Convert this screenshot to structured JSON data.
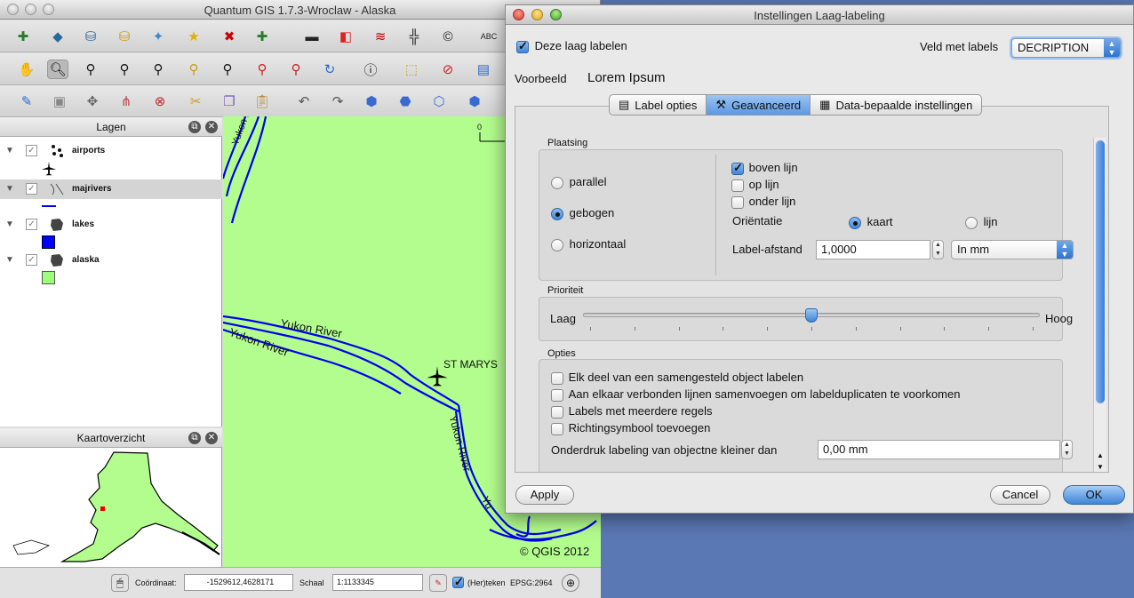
{
  "main_window": {
    "title": "Quantum GIS 1.7.3-Wroclaw - Alaska",
    "layers_panel": {
      "title": "Lagen",
      "layers": [
        {
          "name": "airports",
          "checked": true,
          "symbol": "airplane-icon"
        },
        {
          "name": "majrivers",
          "checked": true,
          "symbol": "line-icon",
          "color": "#0000ee"
        },
        {
          "name": "lakes",
          "checked": true,
          "symbol": "polygon-icon",
          "color": "#0000ff"
        },
        {
          "name": "alaska",
          "checked": true,
          "symbol": "polygon-icon",
          "color": "#9dfe7c"
        }
      ]
    },
    "overview_panel": {
      "title": "Kaartoverzicht"
    },
    "map": {
      "labels": {
        "river_1": "Yukon River",
        "river_2": "Yukon River",
        "river_3": "Yukon River",
        "river_4": "Yu",
        "airport": "ST MARYS"
      },
      "copyright": "© QGIS 2012",
      "scalebar_label": "0",
      "background_color": "#b3fd8e",
      "river_color": "#0000ee"
    },
    "statusbar": {
      "coord_label": "Coördinaat:",
      "coord_value": "-1529612,4628171",
      "scale_label": "Schaal",
      "scale_value": "1:1133345",
      "render_label": "(Her)teken",
      "render_checked": true,
      "crs_label": "EPSG:2964"
    }
  },
  "dialog": {
    "title": "Instellingen Laag-labeling",
    "label_layer": {
      "label": "Deze laag labelen",
      "checked": true
    },
    "field_label": "Veld met labels",
    "field_value": "DECRIPTION",
    "preview_label": "Voorbeeld",
    "preview_text": "Lorem Ipsum",
    "tabs": [
      {
        "label": "Label opties",
        "icon": "document-icon",
        "active": false
      },
      {
        "label": "Geavanceerd",
        "icon": "tools-icon",
        "active": true
      },
      {
        "label": "Data-bepaalde instellingen",
        "icon": "table-icon",
        "active": false
      }
    ],
    "placement": {
      "title": "Plaatsing",
      "modes": [
        {
          "label": "parallel",
          "checked": false
        },
        {
          "label": "gebogen",
          "checked": true
        },
        {
          "label": "horizontaal",
          "checked": false
        }
      ],
      "positions": [
        {
          "label": "boven lijn",
          "checked": true
        },
        {
          "label": "op lijn",
          "checked": false
        },
        {
          "label": "onder lijn",
          "checked": false
        }
      ],
      "orientation_label": "Oriëntatie",
      "orientation_options": [
        {
          "label": "kaart",
          "checked": true
        },
        {
          "label": "lijn",
          "checked": false
        }
      ],
      "distance_label": "Label-afstand",
      "distance_value": "1,0000",
      "distance_unit": "In mm"
    },
    "priority": {
      "title": "Prioriteit",
      "low_label": "Laag",
      "high_label": "Hoog",
      "value": 0.5,
      "ticks": 11
    },
    "options": {
      "title": "Opties",
      "items": [
        {
          "label": "Elk deel van een samengesteld object labelen",
          "checked": false
        },
        {
          "label": "Aan elkaar verbonden lijnen samenvoegen om labelduplicaten te voorkomen",
          "checked": false
        },
        {
          "label": "Labels met meerdere regels",
          "checked": false
        },
        {
          "label": "Richtingsymbool toevoegen",
          "checked": false
        }
      ],
      "suppress_label": "Onderdruk labeling van objectne kleiner dan",
      "suppress_value": "0,00 mm"
    },
    "buttons": {
      "apply": "Apply",
      "cancel": "Cancel",
      "ok": "OK"
    }
  }
}
